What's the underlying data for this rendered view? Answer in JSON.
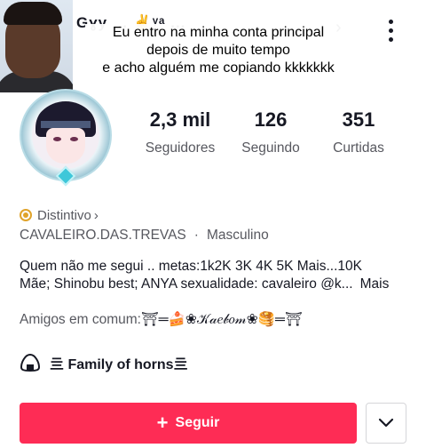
{
  "header": {
    "username": "Gɣy ... ✌️ᵞᵃ ...",
    "caption_lines": [
      "Eu entro na minha conta principal",
      "depois de muito tempo",
      "e acho alguém me copiando kkkkkkk"
    ],
    "icons": [
      "chevron-right-icon",
      "more-vertical-icon"
    ]
  },
  "stats": {
    "followers_value": "2,3 mil",
    "followers_label": "Seguidores",
    "following_value": "126",
    "following_label": "Seguindo",
    "likes_value": "351",
    "likes_label": "Curtidas"
  },
  "badge": {
    "label": "Distintivo",
    "chevron": "›",
    "color": "#e0a32a"
  },
  "meta": {
    "handle": "CAVALEIRO.DAS.TREVAS",
    "separator": "·",
    "gender": "Masculino"
  },
  "bio": {
    "line1": "Quem não me segui .. metas:1k2K 3K 4K 5K Mais...10K",
    "line2": "Mãe; Shinobu best; ANYA sexualidade: cavaleiro @k...",
    "more": "Mais"
  },
  "mutual": {
    "label": "Amigos em comum:",
    "names": "⛩═🍰❀𝒦𝒶𝑒𝒷𝑜𝓂❀🥞═⛩"
  },
  "family": {
    "label": "亖 Family of horns亖",
    "icon": "onigiri-icon"
  },
  "actions": {
    "follow_label": "Seguir",
    "follow_icon": "+",
    "follow_color": "#fe2c55"
  }
}
